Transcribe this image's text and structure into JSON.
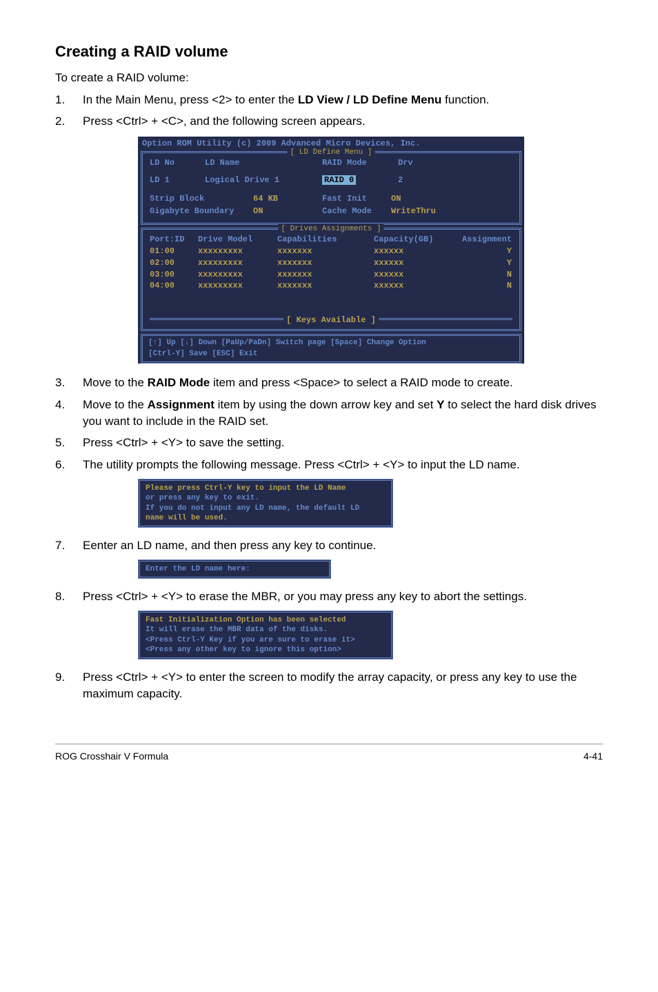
{
  "heading": "Creating a RAID volume",
  "intro": "To create a RAID volume:",
  "steps": {
    "1": {
      "num": "1.",
      "pre": "In the Main Menu, press <2> to enter the ",
      "bold": "LD View / LD Define Menu",
      "post": " function."
    },
    "2": {
      "num": "2.",
      "text": "Press <Ctrl> + <C>, and the following screen appears."
    },
    "3": {
      "num": "3.",
      "pre": "Move to the ",
      "bold": "RAID Mode",
      "post": " item and press <Space> to select a RAID mode to create."
    },
    "4": {
      "num": "4.",
      "pre1": "Move to the ",
      "bold1": "Assignment",
      "mid": " item by using the down arrow key and set ",
      "bold2": "Y",
      "post": " to select the hard disk drives you want to include in the RAID set."
    },
    "5": {
      "num": "5.",
      "text": "Press <Ctrl> + <Y> to save the setting."
    },
    "6": {
      "num": "6.",
      "text": "The utility prompts the following message. Press <Ctrl> + <Y> to input the LD name."
    },
    "7": {
      "num": "7.",
      "text": "Eenter an LD name, and then press any key to continue."
    },
    "8": {
      "num": "8.",
      "text": "Press <Ctrl> + <Y> to erase the MBR, or you may press any key to abort the settings."
    },
    "9": {
      "num": "9.",
      "text": "Press <Ctrl> + <Y> to enter the screen to modify the array capacity, or press any key to use the maximum capacity."
    }
  },
  "bios": {
    "title": "Option ROM Utility (c) 2009 Advanced Micro Devices, Inc.",
    "frame1_label": "[ LD Define Menu ]",
    "ld_no_hdr": "LD No",
    "ld_name_hdr": "LD Name",
    "raid_mode_hdr": "RAID Mode",
    "drv_hdr": "Drv",
    "ld_row_no": "LD  1",
    "ld_row_name": "Logical Drive 1",
    "ld_row_raid": "RAID 0",
    "ld_row_drv": "2",
    "strip_label": "Strip Block",
    "strip_val": "64 KB",
    "fastinit_label": "Fast Init",
    "fastinit_val": "ON",
    "gb_label": "Gigabyte Boundary",
    "gb_val": "ON",
    "cache_label": "Cache Mode",
    "cache_val": "WriteThru",
    "frame2_label": "[ Drives Assignments ]",
    "dh_port": "Port:ID",
    "dh_model": "Drive Model",
    "dh_cap": "Capabilities",
    "dh_capacity": "Capacity(GB)",
    "dh_assign": "Assignment",
    "drives": [
      {
        "port": "01:00",
        "model": "xxxxxxxxx",
        "cap": "xxxxxxx",
        "capacity": "xxxxxx",
        "assign": "Y"
      },
      {
        "port": "02:00",
        "model": "xxxxxxxxx",
        "cap": "xxxxxxx",
        "capacity": "xxxxxx",
        "assign": "Y"
      },
      {
        "port": "03:00",
        "model": "xxxxxxxxx",
        "cap": "xxxxxxx",
        "capacity": "xxxxxx",
        "assign": "N"
      },
      {
        "port": "04:00",
        "model": "xxxxxxxxx",
        "cap": "xxxxxxx",
        "capacity": "xxxxxx",
        "assign": "N"
      }
    ],
    "keys_label": "[ Keys Available ]",
    "footer1": "[↑] Up  [↓] Down  [PaUp/PaDn] Switch page  [Space] Change Option",
    "footer2": "[Ctrl-Y] Save  [ESC] Exit"
  },
  "prompt1": {
    "l1": "Please press Ctrl-Y key to input the LD Name",
    "l2": "or press any key to exit.",
    "l3": "If you do not input any LD name, the default LD",
    "l4": "name will be used."
  },
  "prompt2": "Enter the LD name here:",
  "prompt3": {
    "l1": "Fast Initialization Option has been selected",
    "l2": "It will erase the MBR data of the disks.",
    "l3": "<Press Ctrl-Y Key if you are sure to erase it>",
    "l4": "<Press any other key to ignore this option>"
  },
  "footer": {
    "left": "ROG Crosshair V Formula",
    "right": "4-41"
  }
}
